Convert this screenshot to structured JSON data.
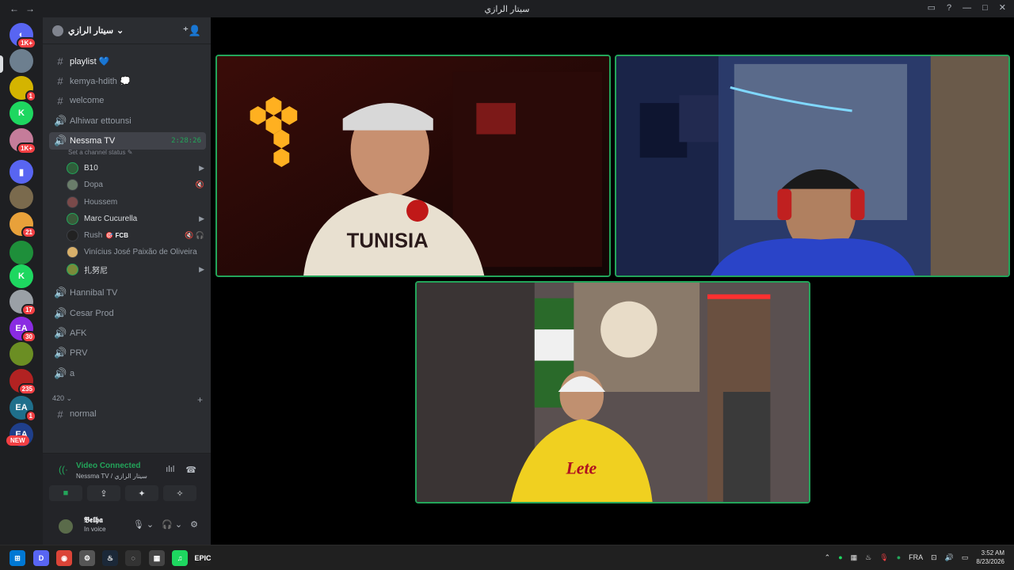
{
  "window": {
    "title": "سيتار الرازي",
    "back": "←",
    "forward": "→"
  },
  "servers": {
    "items": [
      {
        "name": "discord-home",
        "badge": "1K+",
        "glyph": "◐",
        "color": "#5865f2"
      },
      {
        "name": "server-1",
        "badge": "",
        "glyph": "",
        "color": "#6d7f8f"
      },
      {
        "name": "server-2",
        "badge": "1",
        "glyph": "",
        "color": "#d4b400"
      },
      {
        "name": "server-3",
        "badge": "",
        "glyph": "K",
        "color": "#1ed760"
      },
      {
        "name": "server-4",
        "badge": "1K+",
        "glyph": "",
        "color": "#c57c9a"
      },
      {
        "name": "server-folder",
        "badge": "",
        "glyph": "▮",
        "color": "#5865f2"
      },
      {
        "name": "server-5",
        "badge": "",
        "glyph": "",
        "color": "#7a6a4d"
      },
      {
        "name": "server-6",
        "badge": "21",
        "glyph": "",
        "color": "#e8a13a"
      },
      {
        "name": "server-7",
        "badge": "",
        "glyph": "",
        "color": "#1e8f3a"
      },
      {
        "name": "server-8",
        "badge": "",
        "glyph": "K",
        "color": "#1ed760"
      },
      {
        "name": "server-9",
        "badge": "17",
        "glyph": "",
        "color": "#9aa0a6"
      },
      {
        "name": "server-10",
        "badge": "30",
        "glyph": "EA",
        "color": "#8a2be2"
      },
      {
        "name": "server-11",
        "badge": "",
        "glyph": "",
        "color": "#6b8e23"
      },
      {
        "name": "server-12",
        "badge": "235",
        "glyph": "",
        "color": "#b22222"
      },
      {
        "name": "server-13",
        "badge": "1",
        "glyph": "EA",
        "color": "#1f6f8b"
      },
      {
        "name": "server-14",
        "badge": "",
        "glyph": "EA",
        "color": "#1f3f8b"
      }
    ],
    "new_label": "NEW"
  },
  "guild": {
    "name": "سيتار الرازي",
    "chevron": "⌄"
  },
  "channels": [
    {
      "type": "#",
      "name": "playlist 💙",
      "bright": true
    },
    {
      "type": "#",
      "name": "kemya-hdith 💭",
      "bright": false
    },
    {
      "type": "#",
      "name": "welcome",
      "bright": false
    },
    {
      "type": "🔊",
      "name": "Alhiwar ettounsi",
      "bright": false
    },
    {
      "type": "🔊",
      "name": "Nessma TV",
      "bright": true,
      "active": true,
      "timer": "2:28:26"
    }
  ],
  "channel_status": "Set a channel status ✎",
  "members": [
    {
      "name": "B10",
      "icon": "▶",
      "live": true,
      "bright": true,
      "color": "#2f5e3a"
    },
    {
      "name": "Dopa",
      "icon": "🔇",
      "live": false,
      "bright": false,
      "color": "#6a7d6a"
    },
    {
      "name": "Houssem",
      "icon": "",
      "live": false,
      "bright": false,
      "color": "#7a4a4a"
    },
    {
      "name": "Marc Cucurella",
      "icon": "▶",
      "live": true,
      "bright": true,
      "color": "#3a5a3a"
    },
    {
      "name": "Rush",
      "tag": "🎯 FCB",
      "icon": "🔇 🎧",
      "live": false,
      "bright": false,
      "color": "#222"
    },
    {
      "name": "Vinícius José Paixão de Oliveira",
      "icon": "",
      "live": false,
      "bright": false,
      "color": "#d8b06a"
    },
    {
      "name": "扎努尼",
      "icon": "▶",
      "live": true,
      "bright": true,
      "color": "#7a8a3a"
    }
  ],
  "channels_lower": [
    {
      "type": "🔊",
      "name": "Hannibal TV"
    },
    {
      "type": "🔊",
      "name": "Cesar Prod"
    },
    {
      "type": "🔊",
      "name": "AFK"
    },
    {
      "type": "🔊",
      "name": "PRV"
    },
    {
      "type": "🔊",
      "name": "a"
    }
  ],
  "category": {
    "name": "420 ⌄",
    "plus": "+"
  },
  "category_channel": {
    "type": "#",
    "name": "normal"
  },
  "voice_panel": {
    "title": "Video Connected",
    "subtitle": "Nessma TV / سيتار الرازي",
    "signal": "((·",
    "wave": "ılıl",
    "disconnect": "☎",
    "buttons": [
      "■",
      "⇪",
      "✦",
      "✧"
    ]
  },
  "user": {
    "name": "𝕭𝖊𝖑𝖍𝖆",
    "status": "In voice",
    "mic": "🎙 ⌄",
    "headset": "🎧 ⌄",
    "settings": "⚙"
  },
  "taskbar": {
    "apps": [
      "⊞",
      "D",
      "◉",
      "⚙",
      "♨",
      "◌",
      "▦",
      "♫",
      "EPIC"
    ],
    "lang": "FRA",
    "time": "3:52 AM",
    "date": "8/23/2026"
  }
}
